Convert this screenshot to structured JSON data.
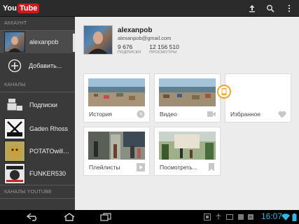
{
  "app": {
    "logo_you": "You",
    "logo_tube": "Tube"
  },
  "actionbar": {
    "upload_icon": "upload-icon",
    "search_icon": "search-icon",
    "menu_icon": "overflow-menu-icon"
  },
  "sidebar": {
    "account_header": "АККАУНТ",
    "account_name": "alexanpob",
    "add_label": "Добавить...",
    "channels_header": "КАНАЛЫ",
    "channels": [
      {
        "label": "Подписки"
      },
      {
        "label": "Gaden Rhoss"
      },
      {
        "label": "POTATOwillEA..."
      },
      {
        "label": "FUNKER530"
      }
    ],
    "youtube_channels_header": "КАНАЛЫ YOUTUBE"
  },
  "profile": {
    "name": "alexanpob",
    "email": "alexanpob@gmail.com",
    "subscribers_value": "9 676",
    "subscribers_label": "ПОДПИСКИ",
    "views_value": "12 156 510",
    "views_label": "ПРОСМОТРЫ"
  },
  "tiles": [
    {
      "label": "История",
      "icon": "clock-icon"
    },
    {
      "label": "Видео",
      "icon": "video-camera-icon"
    },
    {
      "label": "Избранное",
      "icon": "heart-icon"
    },
    {
      "label": "Плейлисты",
      "icon": "playlist-play-icon"
    },
    {
      "label": "Посмотреть...",
      "icon": "bookmark-icon"
    }
  ],
  "statusbar": {
    "time": "16:07"
  },
  "colors": {
    "accent": "#33b5e5",
    "youtube_red": "#cc181e",
    "sidebar_bg": "#3a3a3a",
    "main_bg": "#ececec",
    "notification_orange": "#f5a623"
  }
}
